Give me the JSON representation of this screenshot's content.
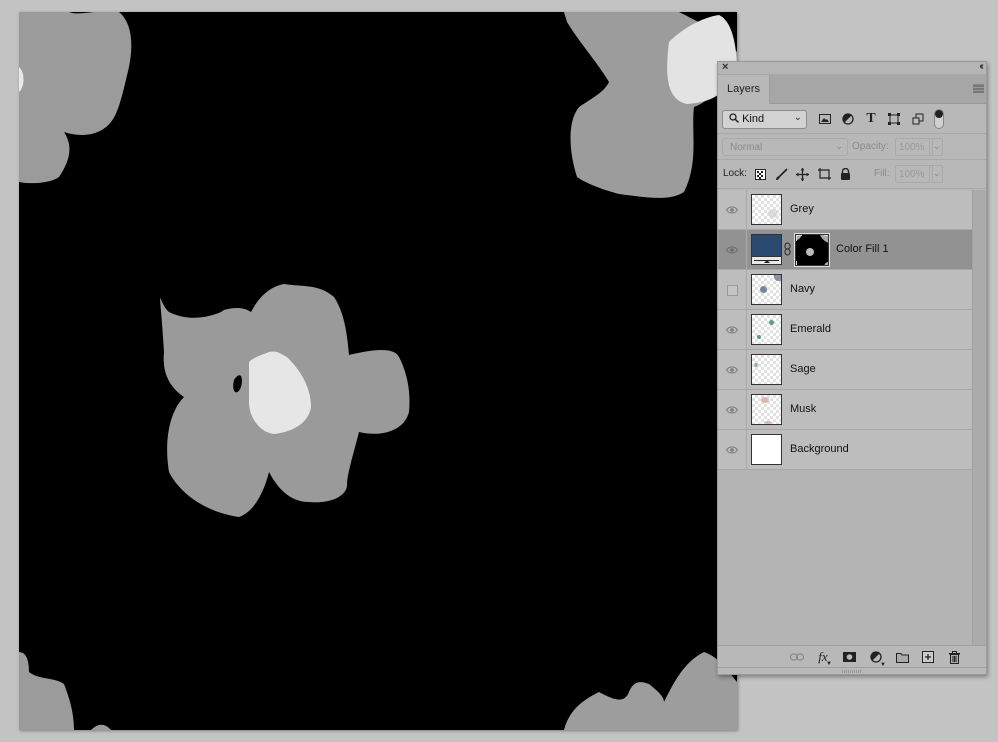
{
  "app": "Photoshop",
  "canvas": {
    "description": "Black background with grey watercolor flowers (tiled pattern)",
    "background_color": "#000000",
    "flower_color": "#9a9a9a",
    "flower_center_color": "#e6e6e6"
  },
  "layers_panel": {
    "tab_label": "Layers",
    "close_glyph": "×",
    "collapse_glyph": "‹‹",
    "filter": {
      "kind_label": "Kind",
      "filter_icons": [
        "pixel-layer-filter-icon",
        "adjustment-layer-filter-icon",
        "type-layer-filter-icon",
        "shape-layer-filter-icon",
        "smart-object-filter-icon"
      ],
      "filter_toggle": "on"
    },
    "blend_mode": "Normal",
    "opacity_label": "Opacity:",
    "opacity_value": "100%",
    "lock_label": "Lock:",
    "fill_label": "Fill:",
    "fill_value": "100%",
    "layers": [
      {
        "name": "Grey",
        "visible": true,
        "selected": false,
        "type": "pixel"
      },
      {
        "name": "Color Fill 1",
        "visible": true,
        "selected": true,
        "type": "fill",
        "fill_color": "#2b4a72"
      },
      {
        "name": "Navy",
        "visible": false,
        "selected": false,
        "type": "pixel"
      },
      {
        "name": "Emerald",
        "visible": true,
        "selected": false,
        "type": "pixel"
      },
      {
        "name": "Sage",
        "visible": true,
        "selected": false,
        "type": "pixel"
      },
      {
        "name": "Musk",
        "visible": true,
        "selected": false,
        "type": "pixel"
      },
      {
        "name": "Background",
        "visible": true,
        "selected": false,
        "type": "background"
      }
    ],
    "footer_buttons": [
      "link-layers",
      "add-layer-style",
      "add-mask",
      "new-fill-adjustment",
      "new-group",
      "new-layer",
      "delete-layer"
    ],
    "fx_label": "fx"
  }
}
